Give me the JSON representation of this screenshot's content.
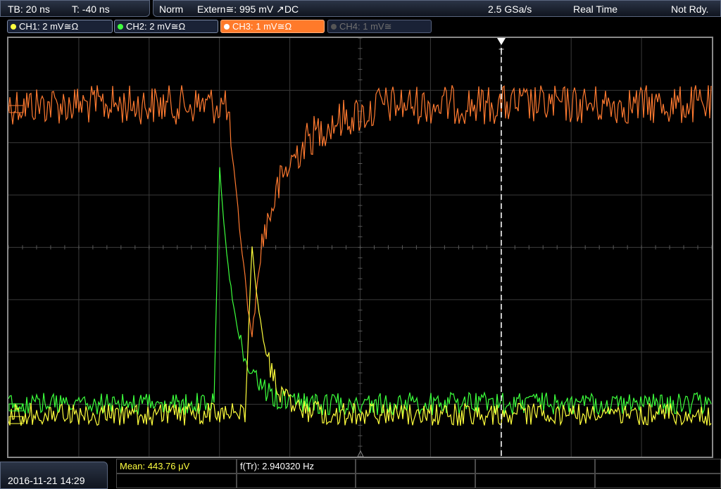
{
  "topbar": {
    "timebase": "TB: 20 ns",
    "trigger_offset": "T: -40 ns",
    "acq_mode": "Norm",
    "trigger_source": "Extern≅: 995 mV ↗DC",
    "sample_rate": "2.5 GSa/s",
    "time_mode": "Real Time",
    "status": "Not Rdy."
  },
  "channels": [
    {
      "label": "CH1: 2 mV≅Ω",
      "color": "#ffff40",
      "active": true
    },
    {
      "label": "CH2: 2 mV≅Ω",
      "color": "#40ff40",
      "active": true
    },
    {
      "label": "CH3: 1 mV≅Ω",
      "color": "#ff7a2a",
      "active": true,
      "selected": true
    },
    {
      "label": "CH4: 1 mV≅",
      "color": "#666666",
      "active": false
    }
  ],
  "trigger_marker": "T",
  "datetime": "2016-11-21 14:29",
  "measurements": {
    "mean": "Mean: 443.76 μV",
    "freq": "f(Tr): 2.940320 Hz"
  },
  "colors": {
    "ch1": "#ffff3c",
    "ch2": "#3cff3c",
    "ch3": "#ff7a30",
    "grid": "#3a3a3a",
    "trigger_line": "#ffffff"
  },
  "icons": [
    "channel-dot-icon",
    "trigger-arrow-icon",
    "ground-marker-icon"
  ]
}
